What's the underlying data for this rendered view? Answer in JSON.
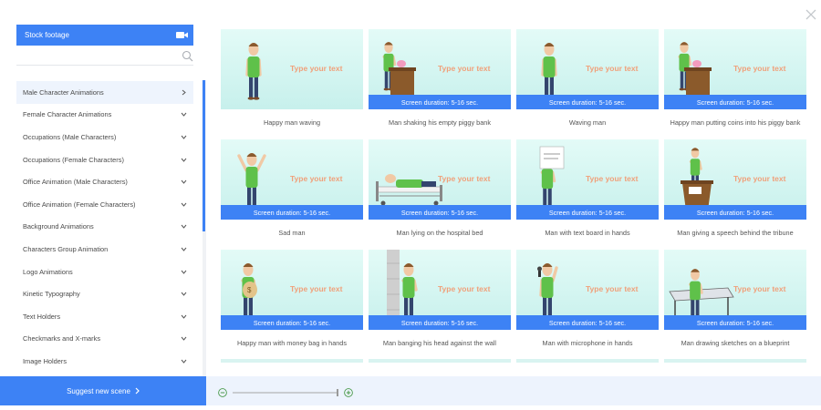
{
  "sidebar": {
    "stock_footage_label": "Stock footage",
    "stock_footage_icon": "video-camera-icon",
    "search_placeholder": "",
    "categories": [
      {
        "label": "Male Character Animations",
        "active": true
      },
      {
        "label": "Female Character Animations",
        "active": false
      },
      {
        "label": "Occupations (Male Characters)",
        "active": false
      },
      {
        "label": "Occupations (Female Characters)",
        "active": false
      },
      {
        "label": "Office Animation (Male Characters)",
        "active": false
      },
      {
        "label": "Office Animation (Female Characters)",
        "active": false
      },
      {
        "label": "Background Animations",
        "active": false
      },
      {
        "label": "Characters Group Animation",
        "active": false
      },
      {
        "label": "Logo Animations",
        "active": false
      },
      {
        "label": "Kinetic Typography",
        "active": false
      },
      {
        "label": "Text Holders",
        "active": false
      },
      {
        "label": "Checkmarks and X-marks",
        "active": false
      },
      {
        "label": "Image Holders",
        "active": false
      }
    ],
    "suggest_label": "Suggest new scene",
    "scroll_fraction": 0.51
  },
  "colors": {
    "accent": "#3d82f5",
    "active_item_bg": "#eef4fd",
    "thumb_bg": "#d2f4f0",
    "type_text": "#f0a07a",
    "shirt": "#5fc14a",
    "pants": "#34456e"
  },
  "scenes": [
    {
      "caption": "Happy man waving",
      "type_text": "Type your text",
      "duration": "",
      "prop": "wave"
    },
    {
      "caption": "Man shaking his empty piggy bank",
      "type_text": "Type your text",
      "duration": "Screen duration: 5-16 sec.",
      "prop": "desk"
    },
    {
      "caption": "Waving man",
      "type_text": "Type your text",
      "duration": "Screen duration: 5-16 sec.",
      "prop": "wave"
    },
    {
      "caption": "Happy man putting coins into his piggy bank",
      "type_text": "Type your text",
      "duration": "Screen duration: 5-16 sec.",
      "prop": "desk"
    },
    {
      "caption": "Sad man",
      "type_text": "Type your text",
      "duration": "Screen duration: 5-16 sec.",
      "prop": "arms-up"
    },
    {
      "caption": "Man lying on the hospital bed",
      "type_text": "Type your text",
      "duration": "Screen duration: 5-16 sec.",
      "prop": "bed"
    },
    {
      "caption": "Man with text board in hands",
      "type_text": "Type your text",
      "duration": "Screen duration: 5-16 sec.",
      "prop": "board"
    },
    {
      "caption": "Man giving a speech behind the tribune",
      "type_text": "Type your text",
      "duration": "Screen duration: 5-16 sec.",
      "prop": "tribune"
    },
    {
      "caption": "Happy man with money bag in hands",
      "type_text": "Type your text",
      "duration": "Screen duration: 5-16 sec.",
      "prop": "bag"
    },
    {
      "caption": "Man banging his head against the wall",
      "type_text": "Type your text",
      "duration": "Screen duration: 5-16 sec.",
      "prop": "wall"
    },
    {
      "caption": "Man with microphone in hands",
      "type_text": "Type your text",
      "duration": "Screen duration: 5-16 sec.",
      "prop": "mic"
    },
    {
      "caption": "Man drawing sketches on a blueprint",
      "type_text": "Type your text",
      "duration": "Screen duration: 5-16 sec.",
      "prop": "blueprint"
    }
  ],
  "zoom": {
    "minus_icon": "zoom-out-icon",
    "plus_icon": "zoom-in-icon",
    "level_fraction": 1.0
  },
  "close_icon": "close-icon"
}
